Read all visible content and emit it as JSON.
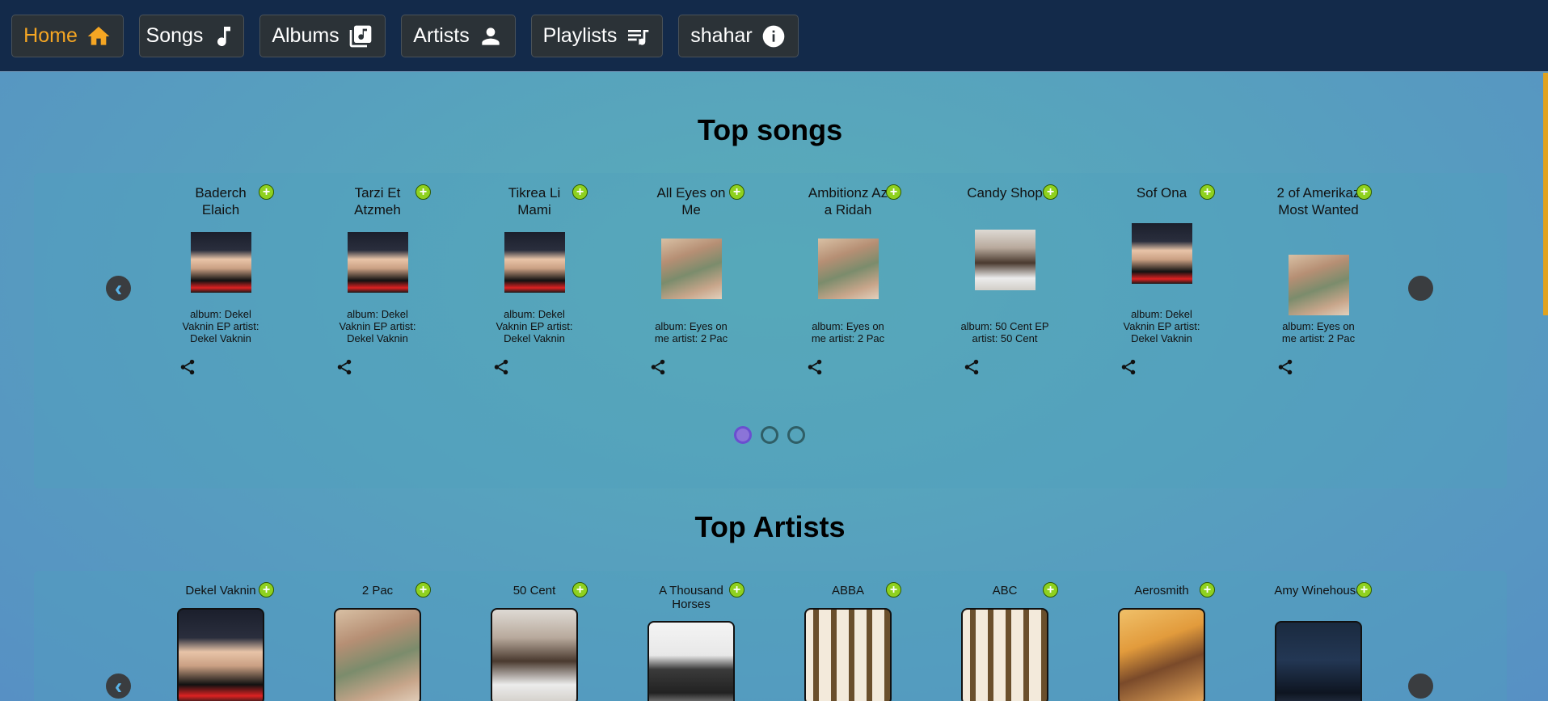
{
  "nav": {
    "items": [
      {
        "label": "Home",
        "icon": "home-icon"
      },
      {
        "label": "Songs",
        "icon": "music-note-icon"
      },
      {
        "label": "Albums",
        "icon": "album-library-icon"
      },
      {
        "label": "Artists",
        "icon": "person-icon"
      },
      {
        "label": "Playlists",
        "icon": "playlist-icon"
      },
      {
        "label": "shahar",
        "icon": "info-icon"
      }
    ],
    "active": "Home",
    "active_color": "#f5a623"
  },
  "top_songs": {
    "heading": "Top songs",
    "songs": [
      {
        "title": "Baderch Elaich",
        "meta": "album:  Dekel Vaknin EP artist: Dekel Vaknin"
      },
      {
        "title": "Tarzi Et Atzmeh",
        "meta": "album:  Dekel Vaknin EP artist: Dekel Vaknin"
      },
      {
        "title": "Tikrea Li Mami",
        "meta": "album:  Dekel Vaknin EP artist: Dekel Vaknin"
      },
      {
        "title": "All Eyes on Me",
        "meta": "album:  Eyes on me artist: 2 Pac"
      },
      {
        "title": "Ambitionz Az a Ridah",
        "meta": "album:  Eyes on me artist: 2 Pac"
      },
      {
        "title": "Candy Shop",
        "meta": "album:  50 Cent EP artist: 50 Cent"
      },
      {
        "title": "Sof Ona",
        "meta": "album:  Dekel Vaknin EP artist: Dekel Vaknin"
      },
      {
        "title": "2 of Amerikaz Most Wanted",
        "meta": "album:  Eyes on me artist: 2 Pac"
      }
    ],
    "page_dots": 3,
    "active_page": 1
  },
  "top_artists": {
    "heading": "Top Artists",
    "artists": [
      {
        "name": "Dekel Vaknin"
      },
      {
        "name": "2 Pac"
      },
      {
        "name": "50 Cent"
      },
      {
        "name": "A Thousand Horses"
      },
      {
        "name": "ABBA"
      },
      {
        "name": "ABC"
      },
      {
        "name": "Aerosmith"
      },
      {
        "name": "Amy Winehouse"
      }
    ]
  },
  "arrows": {
    "prev": "‹",
    "next": ""
  },
  "add_glyph": "+"
}
